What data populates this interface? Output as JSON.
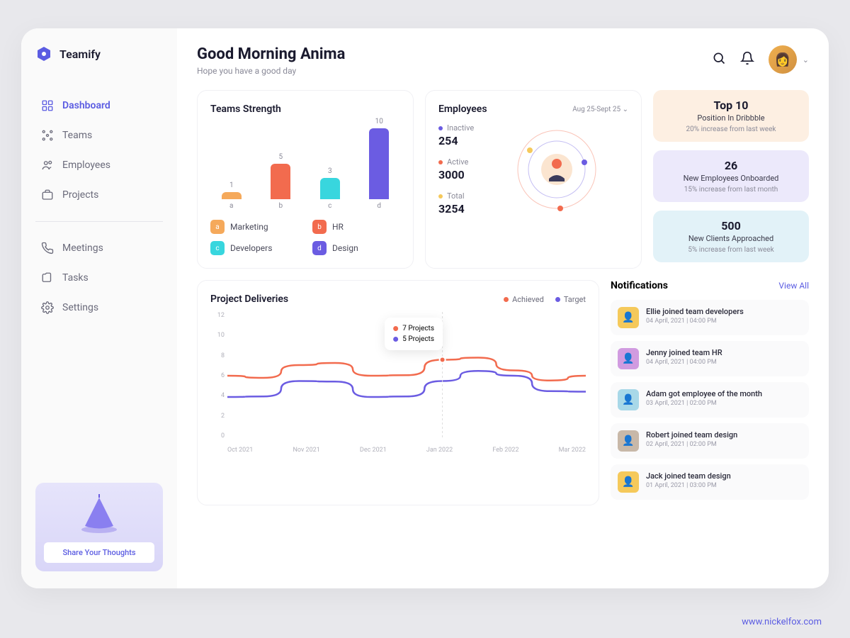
{
  "brand": "Teamify",
  "nav": {
    "primary": [
      {
        "id": "dashboard",
        "label": "Dashboard",
        "active": true
      },
      {
        "id": "teams",
        "label": "Teams"
      },
      {
        "id": "employees",
        "label": "Employees"
      },
      {
        "id": "projects",
        "label": "Projects"
      }
    ],
    "secondary": [
      {
        "id": "meetings",
        "label": "Meetings"
      },
      {
        "id": "tasks",
        "label": "Tasks"
      },
      {
        "id": "settings",
        "label": "Settings"
      }
    ]
  },
  "promo_button": "Share Your Thoughts",
  "header": {
    "title": "Good Morning Anima",
    "subtitle": "Hope you have a good day"
  },
  "teams_card": {
    "title": "Teams Strength",
    "legend": [
      {
        "key": "a",
        "label": "Marketing",
        "color": "#f5a95b"
      },
      {
        "key": "b",
        "label": "HR",
        "color": "#f26b4e"
      },
      {
        "key": "c",
        "label": "Developers",
        "color": "#38d6de"
      },
      {
        "key": "d",
        "label": "Design",
        "color": "#6b5ce2"
      }
    ]
  },
  "employees_card": {
    "title": "Employees",
    "range": "Aug 25-Sept 25",
    "stats": [
      {
        "label": "Inactive",
        "value": "254",
        "color": "#6b5ce2"
      },
      {
        "label": "Active",
        "value": "3000",
        "color": "#f26b4e"
      },
      {
        "label": "Total",
        "value": "3254",
        "color": "#f5c95b"
      }
    ]
  },
  "kpis": [
    {
      "big": "Top 10",
      "sub": "Position In Dribbble",
      "delta": "20% increase from last week",
      "bg": "#fdefe2"
    },
    {
      "big": "26",
      "sub": "New Employees Onboarded",
      "delta": "15% increase from last month",
      "bg": "#ece9fb"
    },
    {
      "big": "500",
      "sub": "New Clients Approached",
      "delta": "5% increase from last week",
      "bg": "#e2f2f8"
    }
  ],
  "deliveries": {
    "title": "Project Deliveries",
    "legend": {
      "achieved": "Achieved",
      "target": "Target"
    },
    "tooltip": {
      "achieved": "7 Projects",
      "target": "5 Projects"
    }
  },
  "notifications": {
    "title": "Notifications",
    "view_all": "View All",
    "items": [
      {
        "text": "Ellie joined team developers",
        "date": "04 April, 2021 | 04:00 PM",
        "bg": "#f5c95b"
      },
      {
        "text": "Jenny joined team HR",
        "date": "04 April, 2021 | 04:00 PM",
        "bg": "#d19be0"
      },
      {
        "text": "Adam got employee of the month",
        "date": "03 April, 2021 | 02:00 PM",
        "bg": "#a8d8e8"
      },
      {
        "text": "Robert joined team design",
        "date": "02 April, 2021 | 02:00 PM",
        "bg": "#c8b8a8"
      },
      {
        "text": "Jack joined team design",
        "date": "01 April, 2021 | 03:00 PM",
        "bg": "#f5c95b"
      }
    ]
  },
  "credit": "www.nickelfox.com",
  "chart_data": [
    {
      "type": "bar",
      "title": "Teams Strength",
      "categories": [
        "a",
        "b",
        "c",
        "d"
      ],
      "values": [
        1,
        5,
        3,
        10
      ],
      "colors": [
        "#f5a95b",
        "#f26b4e",
        "#38d6de",
        "#6b5ce2"
      ],
      "series_labels": {
        "a": "Marketing",
        "b": "HR",
        "c": "Developers",
        "d": "Design"
      }
    },
    {
      "type": "line",
      "title": "Project Deliveries",
      "x": [
        "Oct 2021",
        "Nov 2021",
        "Dec 2021",
        "Jan 2022",
        "Feb 2022",
        "Mar 2022"
      ],
      "series": [
        {
          "name": "Achieved",
          "color": "#f26b4e",
          "values": [
            6,
            7,
            6,
            7.5,
            6.5,
            6
          ]
        },
        {
          "name": "Target",
          "color": "#6b5ce2",
          "values": [
            4,
            5.5,
            4,
            5.5,
            6,
            4.5
          ]
        }
      ],
      "ylim": [
        0,
        12
      ],
      "y_ticks": [
        0,
        2,
        4,
        6,
        8,
        10,
        12
      ]
    }
  ]
}
